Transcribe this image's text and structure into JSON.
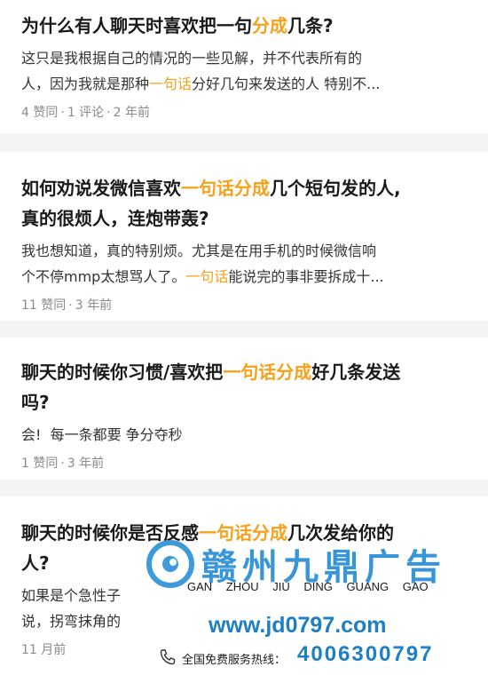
{
  "colors": {
    "highlight": "#f5a11a",
    "title": "#1a1a1a",
    "meta": "#8a8a8a",
    "background": "#f4f4f4",
    "watermark_blue": "#2a8fd6"
  },
  "items": [
    {
      "title": {
        "pre": "为什么有人聊天时喜欢把一句",
        "hl": "分成",
        "post": "几条?"
      },
      "excerpt": {
        "line1": "这只是我根据自己的情况的一些见解，并不代表所有的",
        "line2_pre": "人，因为我就是那种",
        "line2_hl": "一句话",
        "line2_post": "分好几句来发送的人 特别不..."
      },
      "meta": {
        "likes": "4 赞同",
        "comments": "1 评论",
        "time": "2 年前"
      }
    },
    {
      "title": {
        "line1_pre": "如何劝说发微信喜欢",
        "line1_hl": "一句话分成",
        "line1_post": "几个短句发的人,",
        "line2": "真的很烦人，连炮带轰?"
      },
      "excerpt": {
        "line1": "我也想知道，真的特别烦。尤其是在用手机的时候微信响",
        "line2_pre": "个不停mmp太想骂人了。",
        "line2_hl": "一句话",
        "line2_post": "能说完的事非要拆成十..."
      },
      "meta": {
        "likes": "11 赞同",
        "time": "3 年前"
      }
    },
    {
      "title": {
        "line1_pre": "聊天的时候你习惯/喜欢把",
        "line1_hl": "一句话分成",
        "line1_post": "好几条发送",
        "line2": "吗?"
      },
      "excerpt": {
        "line1": "会!  每一条都要 争分夺秒"
      },
      "meta": {
        "likes": "1 赞同",
        "time": "3 年前"
      }
    },
    {
      "title": {
        "line1_pre": "聊天的时候你是否反感",
        "line1_hl": "一句话分成",
        "line1_post": "几次发给你的",
        "line2": "人?"
      },
      "excerpt": {
        "line1": "如果是个急性子",
        "line2": "说，拐弯抹角的"
      },
      "meta": {
        "time": "11 月前"
      }
    }
  ],
  "watermark": {
    "logo_icon": "swirl-logo-icon",
    "title": "赣州九鼎广告",
    "pinyin": "GAN ZHOU JIU DING GUANG GAO",
    "url": "www.jd0797.com",
    "phone_icon": "phone-icon",
    "hotline_label": "全国免费服务热线：",
    "hotline_number": "4006300797"
  }
}
